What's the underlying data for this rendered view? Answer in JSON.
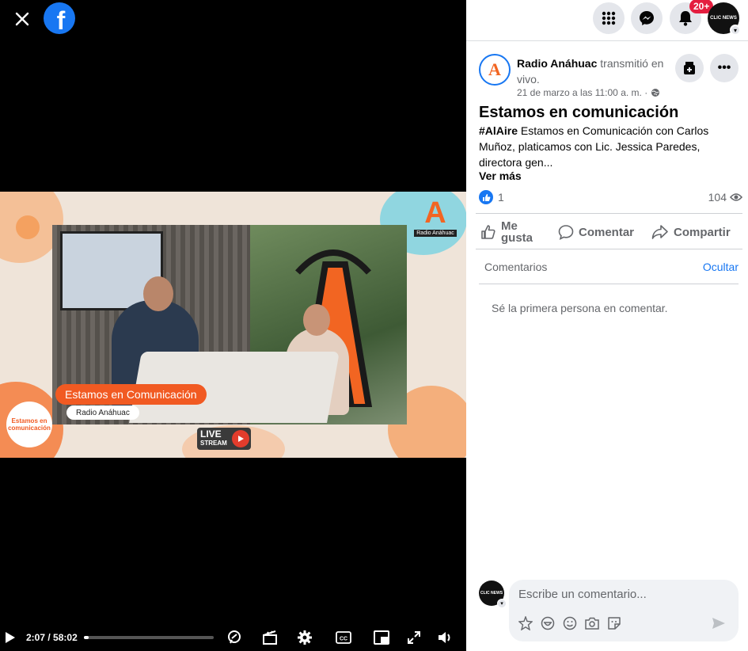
{
  "viewer": {
    "time_current": "2:07",
    "time_total": "58:02",
    "progress_fraction": 0.036
  },
  "video": {
    "lower_third_title": "Estamos en Comunicación",
    "lower_third_sub": "Radio Anáhuac",
    "logo_letter": "A",
    "logo_text": "Radio Anáhuac",
    "live_badge_line1": "LIVE",
    "live_badge_line2": "STREAM",
    "show_logo_text": "Estamos en comunicación"
  },
  "topbar": {
    "notifications_badge": "20+",
    "profile_name_text": "CLIC NEWS"
  },
  "post": {
    "author": "Radio Anáhuac",
    "action_text": " transmitió en vivo.",
    "date": "21 de marzo a las 11:00 a. m. ·",
    "title": "Estamos en comunicación",
    "hashtag": "#AlAire",
    "body": " Estamos en Comunicación con Carlos Muñoz, platicamos con Lic. Jessica Paredes, directora gen...",
    "see_more": "Ver más",
    "like_count": "1",
    "view_count": "104"
  },
  "actions": {
    "like_line1": "Me",
    "like_line2": "gusta",
    "comment": "Comentar",
    "share": "Compartir"
  },
  "comments": {
    "label": "Comentarios",
    "hide": "Ocultar",
    "empty_text": "Sé la primera persona en comentar.",
    "composer_placeholder": "Escribe un comentario...",
    "composer_avatar_text": "CLIC NEWS"
  },
  "colors": {
    "facebook_blue": "#1877f2",
    "badge_red": "#e41e3f",
    "brand_orange": "#f15a22"
  }
}
